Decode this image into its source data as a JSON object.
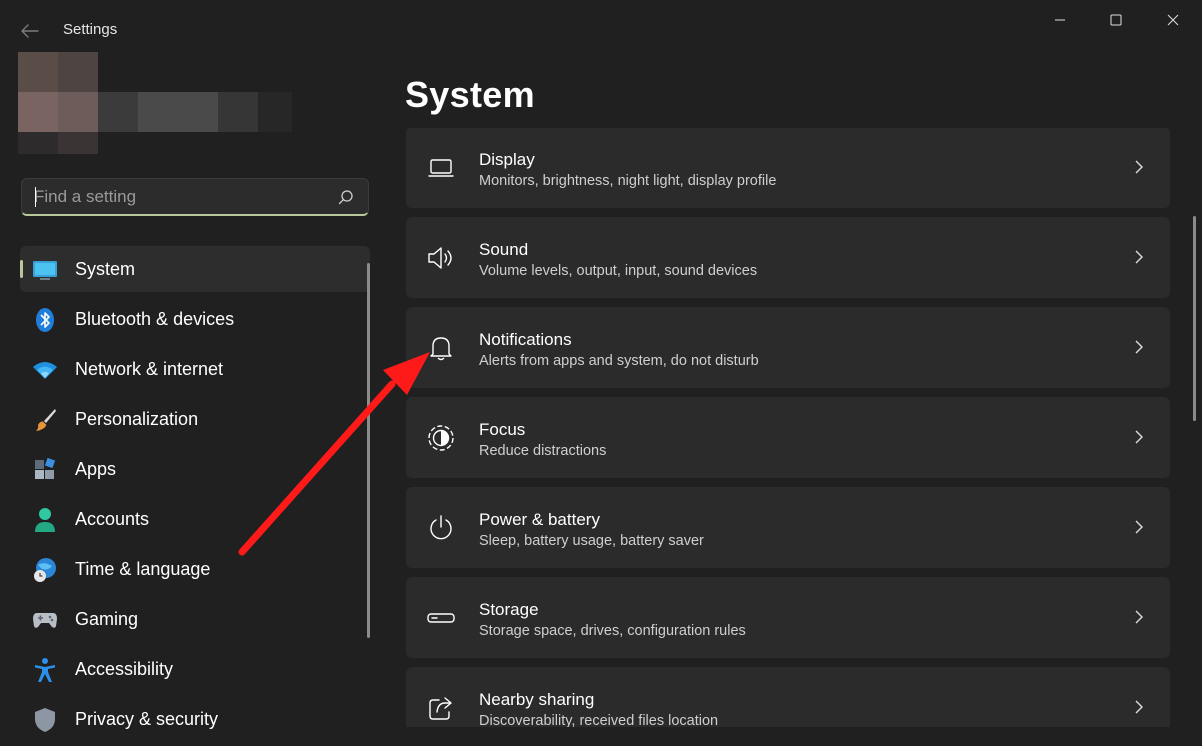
{
  "window": {
    "title": "Settings",
    "controls": [
      "minimize-icon",
      "maximize-icon",
      "close-icon"
    ]
  },
  "search": {
    "placeholder": "Find a setting",
    "value": ""
  },
  "sidebar": {
    "items": [
      {
        "label": "System",
        "icon": "monitor-icon",
        "active": true
      },
      {
        "label": "Bluetooth & devices",
        "icon": "bluetooth-icon"
      },
      {
        "label": "Network & internet",
        "icon": "wifi-icon"
      },
      {
        "label": "Personalization",
        "icon": "brush-icon"
      },
      {
        "label": "Apps",
        "icon": "apps-icon"
      },
      {
        "label": "Accounts",
        "icon": "person-icon"
      },
      {
        "label": "Time & language",
        "icon": "globe-clock-icon"
      },
      {
        "label": "Gaming",
        "icon": "gamepad-icon"
      },
      {
        "label": "Accessibility",
        "icon": "accessibility-icon"
      },
      {
        "label": "Privacy & security",
        "icon": "shield-icon"
      }
    ]
  },
  "main": {
    "title": "System",
    "cards": [
      {
        "title": "Display",
        "subtitle": "Monitors, brightness, night light, display profile",
        "icon": "display-icon"
      },
      {
        "title": "Sound",
        "subtitle": "Volume levels, output, input, sound devices",
        "icon": "speaker-icon"
      },
      {
        "title": "Notifications",
        "subtitle": "Alerts from apps and system, do not disturb",
        "icon": "bell-icon"
      },
      {
        "title": "Focus",
        "subtitle": "Reduce distractions",
        "icon": "focus-icon"
      },
      {
        "title": "Power & battery",
        "subtitle": "Sleep, battery usage, battery saver",
        "icon": "power-icon"
      },
      {
        "title": "Storage",
        "subtitle": "Storage space, drives, configuration rules",
        "icon": "storage-icon"
      },
      {
        "title": "Nearby sharing",
        "subtitle": "Discoverability, received files location",
        "icon": "share-icon"
      }
    ]
  },
  "colors": {
    "background": "#202020",
    "card": "#2b2b2b",
    "accent": "#b9c89a",
    "annotation_arrow": "#ff1a1a"
  }
}
